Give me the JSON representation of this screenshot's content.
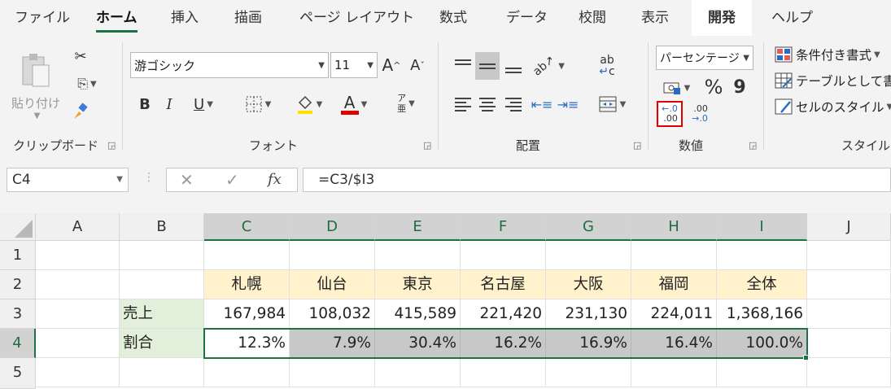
{
  "tabs": [
    "ファイル",
    "ホーム",
    "挿入",
    "描画",
    "ページ レイアウト",
    "数式",
    "データ",
    "校閲",
    "表示",
    "開発",
    "ヘルプ"
  ],
  "ribbon": {
    "clipboard": {
      "paste": "貼り付け",
      "label": "クリップボード"
    },
    "font": {
      "name": "游ゴシック",
      "size": "11",
      "grow": "A",
      "shrink": "A",
      "bold": "B",
      "italic": "I",
      "underline": "U",
      "fontcolor": "A",
      "phonetic_top": "ア",
      "phonetic_bottom": "亜",
      "label": "フォント"
    },
    "alignment": {
      "wrap_top": "ab",
      "wrap_bottom": "c",
      "label": "配置"
    },
    "number": {
      "format": "パーセンテージ",
      "percent": "%",
      "comma": "9",
      "inc_top": "←.0",
      "inc_bottom": ".00",
      "dec_top": ".00",
      "dec_bottom": "→.0",
      "label": "数値"
    },
    "styles": {
      "conditional": "条件付き書式",
      "table": "テーブルとして書式設定",
      "cell": "セルのスタイル",
      "label": "スタイル"
    }
  },
  "formula_bar": {
    "name_box": "C4",
    "cancel": "✕",
    "enter": "✓",
    "fx": "fx",
    "formula": "=C3/$I3"
  },
  "grid": {
    "columns": [
      "A",
      "B",
      "C",
      "D",
      "E",
      "F",
      "G",
      "H",
      "I",
      "J"
    ],
    "rows": [
      "1",
      "2",
      "3",
      "4",
      "5"
    ],
    "header_row": [
      "札幌",
      "仙台",
      "東京",
      "名古屋",
      "大阪",
      "福岡",
      "全体"
    ],
    "sales_label": "売上",
    "sales": [
      "167,984",
      "108,032",
      "415,589",
      "221,420",
      "231,130",
      "224,011",
      "1,368,166"
    ],
    "ratio_label": "割合",
    "ratios": [
      "12.3%",
      "7.9%",
      "30.4%",
      "16.2%",
      "16.9%",
      "16.4%",
      "100.0%"
    ]
  },
  "colors": {
    "accent": "#1e7145",
    "header_fill": "#fff2cc",
    "label_fill": "#e2efda",
    "selection_fill": "#c8c8c8",
    "highlight_red": "#e00000"
  }
}
